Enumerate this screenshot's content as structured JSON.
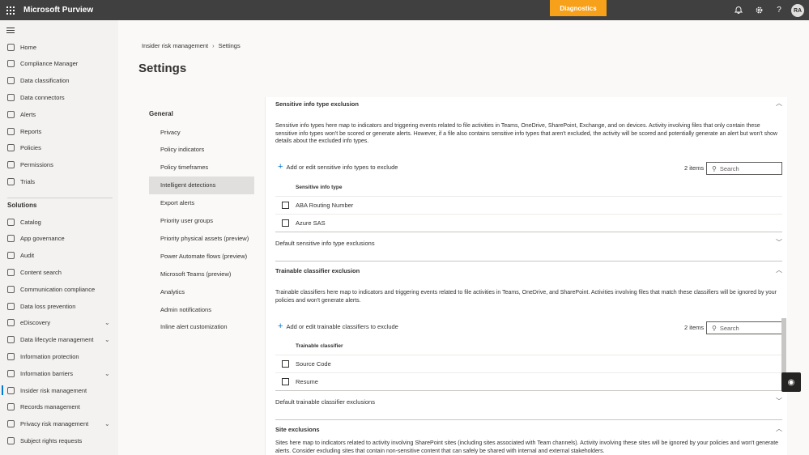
{
  "app": {
    "title": "Microsoft Purview",
    "diagnostics_label": "Diagnostics",
    "avatar_initials": "RA"
  },
  "nav": {
    "items": [
      {
        "label": "Home",
        "icon": "home-icon"
      },
      {
        "label": "Compliance Manager",
        "icon": "trophy-icon"
      },
      {
        "label": "Data classification",
        "icon": "classification-icon"
      },
      {
        "label": "Data connectors",
        "icon": "connector-icon"
      },
      {
        "label": "Alerts",
        "icon": "alert-icon"
      },
      {
        "label": "Reports",
        "icon": "report-icon"
      },
      {
        "label": "Policies",
        "icon": "policy-icon"
      },
      {
        "label": "Permissions",
        "icon": "permissions-icon"
      },
      {
        "label": "Trials",
        "icon": "trials-icon"
      }
    ],
    "solutions_label": "Solutions",
    "solutions": [
      {
        "label": "Catalog",
        "icon": "catalog-icon"
      },
      {
        "label": "App governance",
        "icon": "app-governance-icon"
      },
      {
        "label": "Audit",
        "icon": "audit-icon"
      },
      {
        "label": "Content search",
        "icon": "content-search-icon"
      },
      {
        "label": "Communication compliance",
        "icon": "communication-icon"
      },
      {
        "label": "Data loss prevention",
        "icon": "dlp-icon"
      },
      {
        "label": "eDiscovery",
        "icon": "ediscovery-icon",
        "expandable": true
      },
      {
        "label": "Data lifecycle management",
        "icon": "lifecycle-icon",
        "expandable": true
      },
      {
        "label": "Information protection",
        "icon": "info-protection-icon"
      },
      {
        "label": "Information barriers",
        "icon": "info-barriers-icon",
        "expandable": true
      },
      {
        "label": "Insider risk management",
        "icon": "insider-risk-icon",
        "active": true
      },
      {
        "label": "Records management",
        "icon": "records-icon"
      },
      {
        "label": "Privacy risk management",
        "icon": "privacy-icon",
        "expandable": true
      },
      {
        "label": "Subject rights requests",
        "icon": "subject-rights-icon"
      }
    ]
  },
  "breadcrumb": {
    "parent": "Insider risk management",
    "current": "Settings"
  },
  "page_title": "Settings",
  "settings_nav": {
    "heading": "General",
    "items": [
      {
        "label": "Privacy"
      },
      {
        "label": "Policy indicators"
      },
      {
        "label": "Policy timeframes"
      },
      {
        "label": "Intelligent detections",
        "selected": true
      },
      {
        "label": "Export alerts"
      },
      {
        "label": "Priority user groups"
      },
      {
        "label": "Priority physical assets (preview)"
      },
      {
        "label": "Power Automate flows (preview)"
      },
      {
        "label": "Microsoft Teams (preview)"
      },
      {
        "label": "Analytics"
      },
      {
        "label": "Admin notifications"
      },
      {
        "label": "Inline alert customization"
      }
    ]
  },
  "sensitive": {
    "title": "Sensitive info type exclusion",
    "description": "Sensitive info types here map to indicators and triggering events related to file activities in Teams, OneDrive, SharePoint, Exchange, and on devices. Activity involving files that only contain these sensitive info types won't be scored or generate alerts. However, if a file also contains sensitive info types that aren't excluded, the activity will be scored and potentially generate an alert but won't show details about the excluded info types.",
    "add_label": "Add or edit sensitive info types to exclude",
    "count": "2 items",
    "search_placeholder": "Search",
    "column": "Sensitive info type",
    "rows": [
      "ABA Routing Number",
      "Azure SAS"
    ],
    "default_label": "Default sensitive info type exclusions"
  },
  "trainable": {
    "title": "Trainable classifier exclusion",
    "description": "Trainable classifiers here map to indicators and triggering events related to file activities in Teams, OneDrive, and SharePoint. Activities involving files that match these classifiers will be ignored by your policies and won't generate alerts.",
    "add_label": "Add or edit trainable classifiers to exclude",
    "count": "2 items",
    "search_placeholder": "Search",
    "column": "Trainable classifier",
    "rows": [
      "Source Code",
      "Resume"
    ],
    "default_label": "Default trainable classifier exclusions"
  },
  "site": {
    "title": "Site exclusions",
    "description": "Sites here map to indicators related to activity involving SharePoint sites (including sites associated with Team channels). Activity involving these sites will be ignored by your policies and won't generate alerts. Consider excluding sites that contain non-sensitive content that can safely be shared with internal and external stakeholders."
  },
  "colors": {
    "accent": "#0078d4",
    "topbar": "#404040",
    "diagnostics": "#f7a11a"
  }
}
